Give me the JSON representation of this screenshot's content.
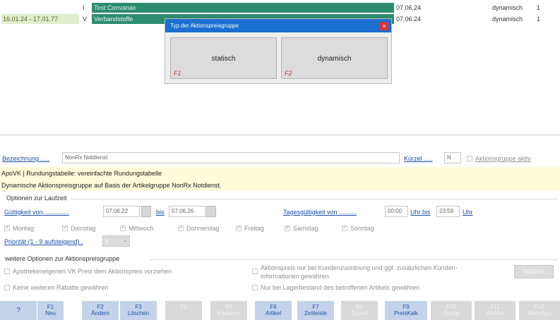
{
  "table": {
    "rows": [
      {
        "date": "",
        "flag": "I",
        "name": "Test Convanax",
        "date2": "07.06.24",
        "type": "dynamisch",
        "num": "1"
      },
      {
        "date": "16.01.24 - 17.01.77",
        "flag": "V",
        "name": "Verbandstoffe",
        "date2": "07.06.24",
        "type": "dynamisch",
        "num": "1"
      }
    ]
  },
  "dialog": {
    "title": "Typ der Aktionspreisgruppe",
    "close": "×",
    "btn1": {
      "label": "statisch",
      "key": "F1"
    },
    "btn2": {
      "label": "dynamisch",
      "key": "F2"
    }
  },
  "form": {
    "bezeichnung_label": "Bezeichnung .....",
    "bezeichnung_value": "NonRx Notdienst",
    "kuerzel_label": "Kürzel .....",
    "kuerzel_value": "N",
    "aktiv_label": "Aktionsgruppe aktiv",
    "info_line1": "ApoVK | Rundungstabelle: vereinfachte Rundungstabelle",
    "info_line2": "Dynamische Aktionspreisgruppe auf Basis der Artikelgruppe NonRx Notdienst.",
    "laufzeit_title": "Optionen zur Laufzeit",
    "gueltig_label": "Gültigkeit von...............",
    "from_date": "07.06.22",
    "bis": "bis",
    "to_date": "07.06.26",
    "tages_label": "Tagesgültigkeit von ..........",
    "from_time": "00:00",
    "uhr_bis": "Uhr bis",
    "to_time": "23:59",
    "uhr": "Uhr",
    "days": [
      "Montag",
      "Dienstag",
      "Mittwoch",
      "Donnerstag",
      "Freitag",
      "Samstag",
      "Sonntag"
    ],
    "prio_label": "Priorität (1 - 9 aufsteigend) .",
    "prio_value": "9",
    "weitere_title": "weitere Optionen zur Aktionspreisgruppe",
    "opt1": "Apothekeneigenen VK Preis dem Aktionspreis vorziehen",
    "opt2": "Keine weiteren Rabatte gewähren",
    "opt3a": "Aktionspreis nur bei Kundenzuordnung und ggf. zusätzlichen Kunden-",
    "opt3b": "informationen gewähren",
    "opt4": "Nur bei Lagerbestand des betroffenen Artikels gewähren",
    "waehlen": "Wählen"
  },
  "fkeys": [
    {
      "key": "?",
      "label": ""
    },
    {
      "key": "F1",
      "label": "Neu"
    },
    {
      "key": "F2",
      "label": "Ändern"
    },
    {
      "key": "F3",
      "label": "Löschen"
    },
    {
      "key": "F4",
      "label": ""
    },
    {
      "key": "F5",
      "label": "Kopieren"
    },
    {
      "key": "F6",
      "label": "Artikel"
    },
    {
      "key": "F7",
      "label": "Zeitleiste"
    },
    {
      "key": "F8",
      "label": "Export"
    },
    {
      "key": "F9",
      "label": "PreisKalk"
    },
    {
      "key": "F10",
      "label": "Suche"
    },
    {
      "key": "F11",
      "label": "Wählen"
    },
    {
      "key": "F12",
      "label": "MehrApo"
    }
  ]
}
